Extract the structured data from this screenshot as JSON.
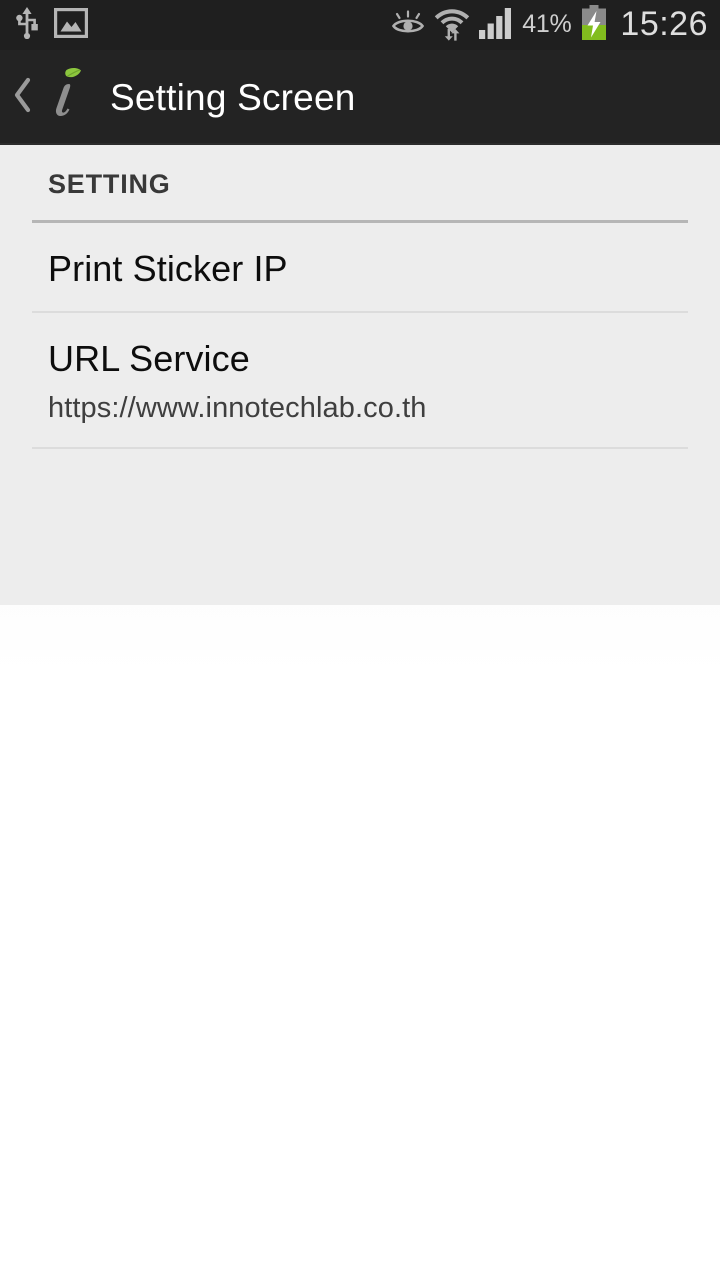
{
  "status_bar": {
    "icons_left": [
      "usb-icon",
      "gallery-image-icon"
    ],
    "icons_right": [
      "smart-stay-eye-icon",
      "wifi-transfer-icon",
      "cellular-signal-icon",
      "battery-charging-icon"
    ],
    "battery_percent": "41%",
    "time": "15:26",
    "colors": {
      "background": "#1f1f1f",
      "icon": "#b0b0b0",
      "text": "#d5d5d5",
      "battery_fill": "#7cb518"
    }
  },
  "action_bar": {
    "back_icon": "back-chevron-icon",
    "logo_icon": "innotech-i-leaf-logo",
    "title": "Setting Screen",
    "colors": {
      "background": "#232323",
      "title": "#ffffff",
      "leaf": "#8cc63e"
    }
  },
  "settings": {
    "section_header": "SETTING",
    "items": [
      {
        "title": "Print Sticker IP",
        "summary": ""
      },
      {
        "title": "URL Service",
        "summary": "https://www.innotechlab.co.th"
      }
    ]
  }
}
